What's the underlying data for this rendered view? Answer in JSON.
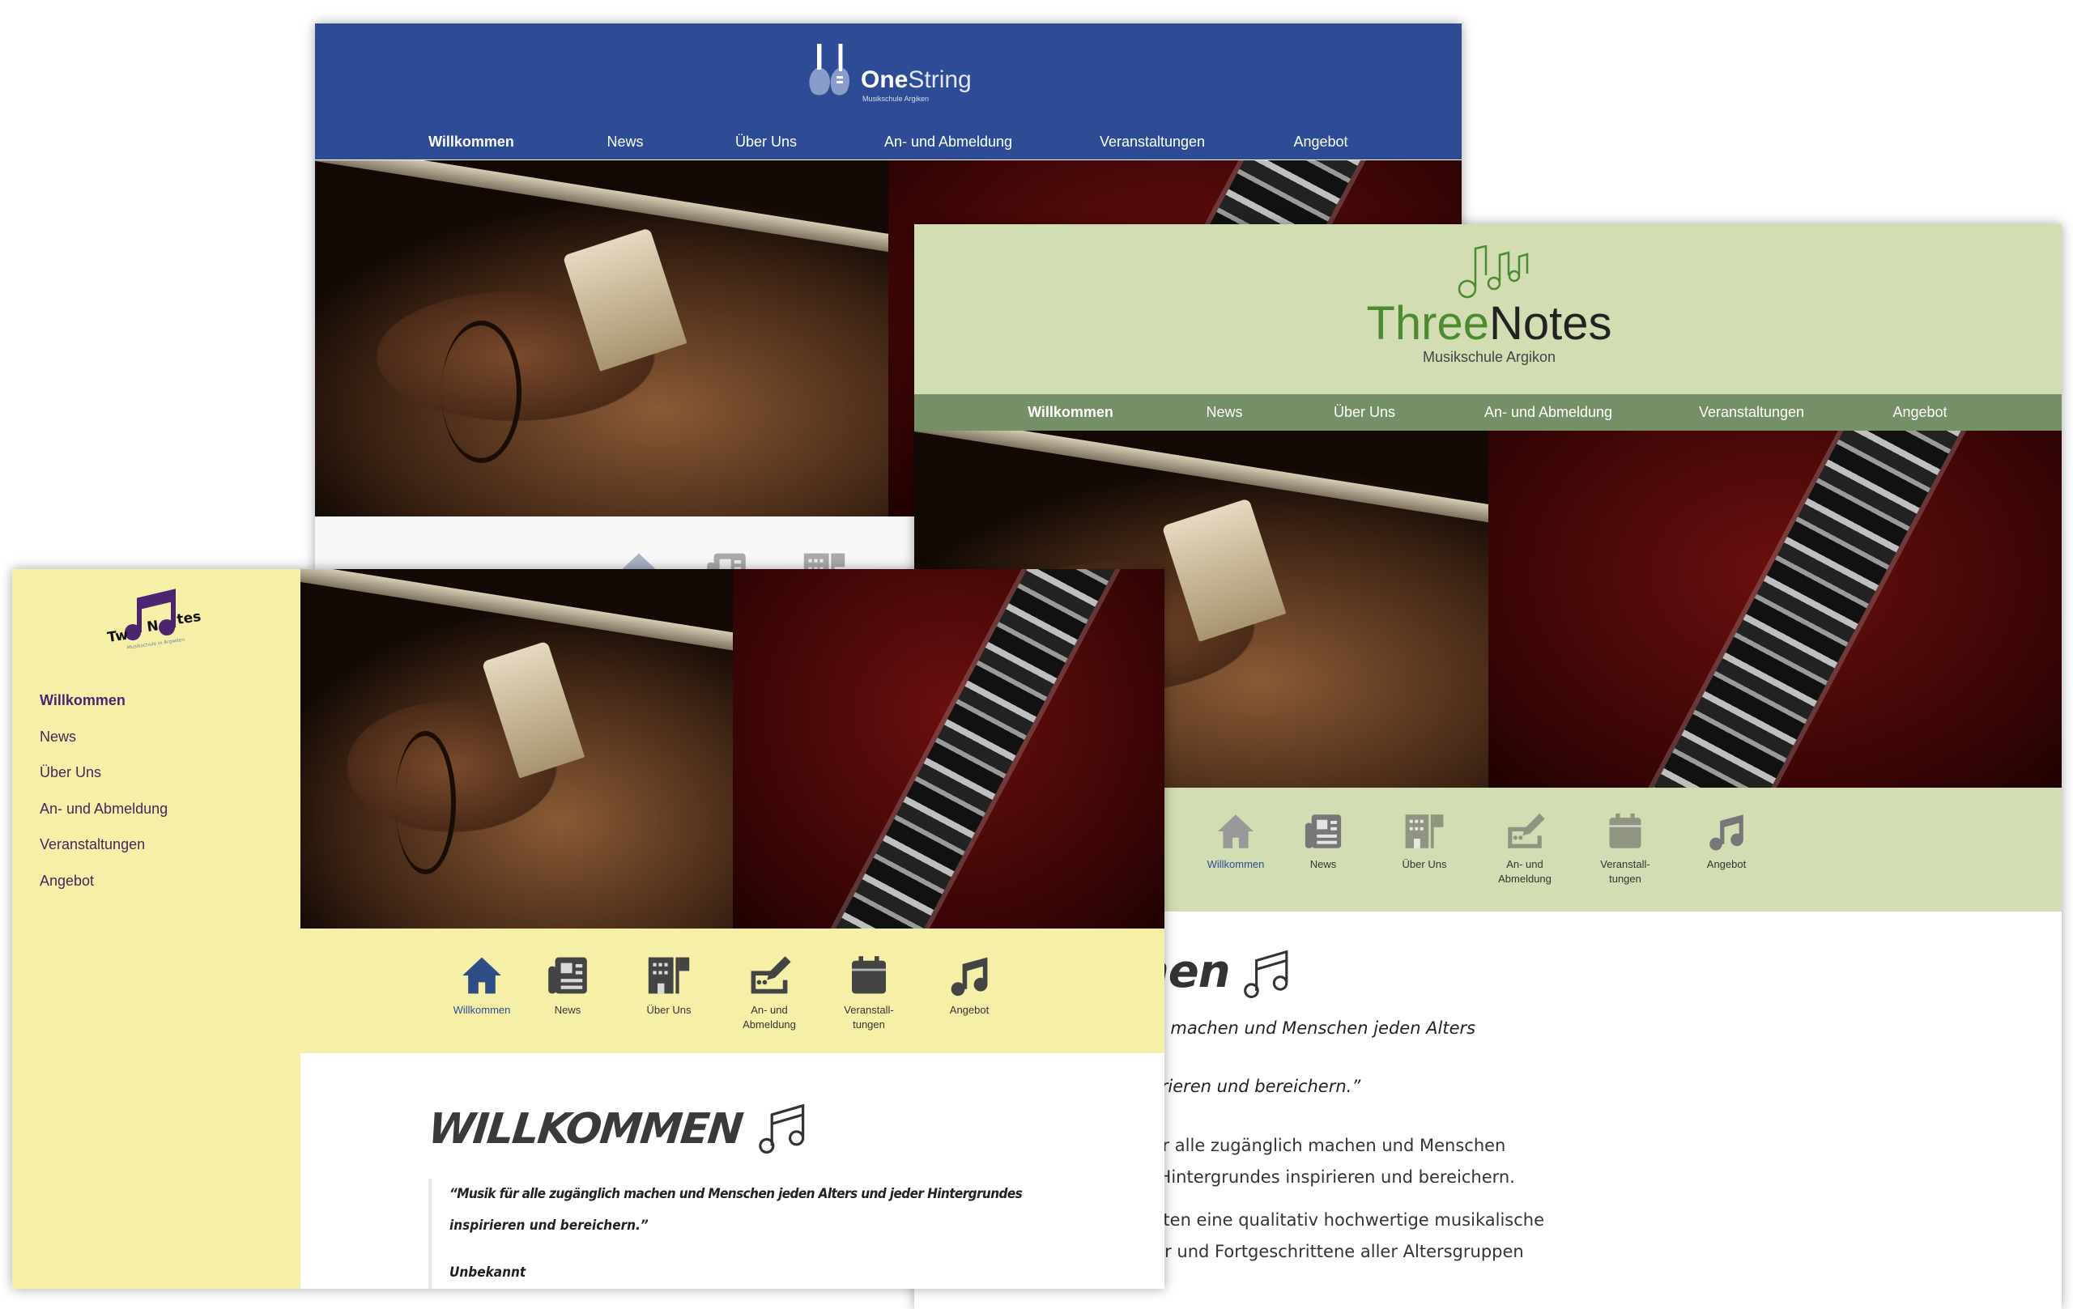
{
  "nav": [
    "Willkommen",
    "News",
    "Über Uns",
    "An- und Abmeldung",
    "Veranstaltungen",
    "Angebot"
  ],
  "icon_nav": [
    {
      "label": "Willkommen",
      "icon": "home-icon"
    },
    {
      "label": "News",
      "icon": "newspaper-icon"
    },
    {
      "label": "Über Uns",
      "icon": "building-flag-icon"
    },
    {
      "label": "An- und Abmeldung",
      "icon": "signup-pen-icon"
    },
    {
      "label": "Veranstall-tungen",
      "icon": "calendar-icon"
    },
    {
      "label": "Angebot",
      "icon": "music-note-icon"
    }
  ],
  "onestring": {
    "logo_strong": "One",
    "logo_light": "String",
    "logo_sub": "Musikschule Argiken",
    "color": "#2e4c96"
  },
  "threenotes": {
    "logo_green": "Three",
    "logo_dark": "Notes",
    "logo_sub": "Musikschule Argikon",
    "header_color": "#d2ddb3",
    "nav_color": "#758f66"
  },
  "twonotes": {
    "logo_text": "TwoNotes",
    "logo_sub": "Musikschule in Argwilen",
    "color": "#f6efa8",
    "accent": "#4b2570"
  },
  "content": {
    "heading": "Willkommen",
    "quote_line1": "“Musik für alle zugänglich machen und Menschen jeden Alters und",
    "quote_line2": "jeder Hintergrundes inspirieren und bereichern.”",
    "quote_full_a": "“Musik für alle zugänglich machen und Menschen jeden Alters und jeder Hintergrundes",
    "quote_full_b": "inspirieren und bereichern.”",
    "author": "Unbekannt",
    "bullets": [
      {
        "l1": "Unsere Vision: Musik für alle zugänglich machen und Menschen",
        "l2": "jeden Alters und jeder Hintergrundes inspirieren und bereichern."
      },
      {
        "l1": "Unsere Mission: Wir bieten eine qualitativ hochwertige musikalische",
        "l2": "Ausbildung für Anfänger und Fortgeschrittene aller Altersgruppen"
      }
    ]
  }
}
